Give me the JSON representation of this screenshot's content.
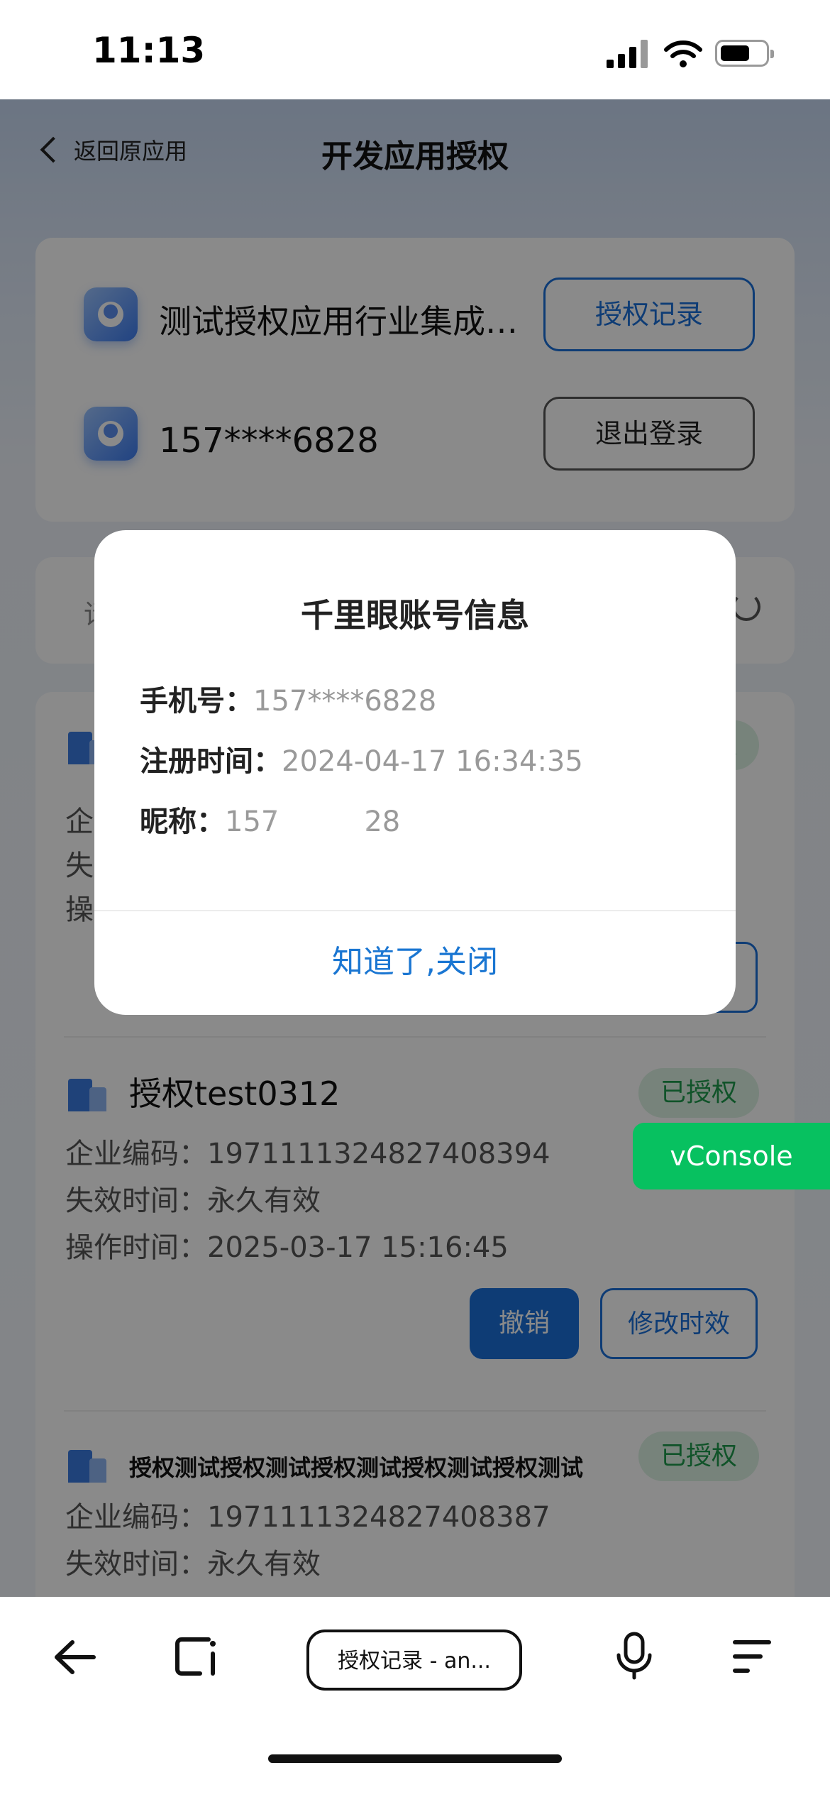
{
  "status_bar": {
    "time": "11:13"
  },
  "header": {
    "back_label": "返回原应用",
    "title": "开发应用授权"
  },
  "top_card": {
    "app_name": "测试授权应用行业集成…",
    "phone": "157****6828",
    "auth_records_button": "授权记录",
    "logout_button": "退出登录"
  },
  "search": {
    "placeholder": "请"
  },
  "records": [
    {
      "name": "",
      "badge": "已授权",
      "lines": [
        "企",
        "失",
        "操"
      ]
    },
    {
      "name": "授权test0312",
      "badge": "已授权",
      "enterprise_code": "企业编码：1971111324827408394",
      "expire": "失效时间：永久有效",
      "operate": "操作时间：2025-03-17 15:16:45",
      "revoke": "撤销",
      "modify": "修改时效"
    },
    {
      "name": "授权测试授权测试授权测试授权测试授权测试",
      "badge": "已授权",
      "enterprise_code": "企业编码：1971111324827408387",
      "expire": "失效时间：永久有效"
    }
  ],
  "dialog": {
    "title": "千里眼账号信息",
    "phone_label": "手机号：",
    "phone_value": "157****6828",
    "reg_label": "注册时间：",
    "reg_value": "2024-04-17 16:34:35",
    "nick_label": "昵称：",
    "nick_prefix": "157",
    "nick_suffix": "28",
    "close_button": "知道了,关闭"
  },
  "vconsole": "vConsole",
  "browser_toolbar": {
    "url_label": "授权记录 - an..."
  }
}
